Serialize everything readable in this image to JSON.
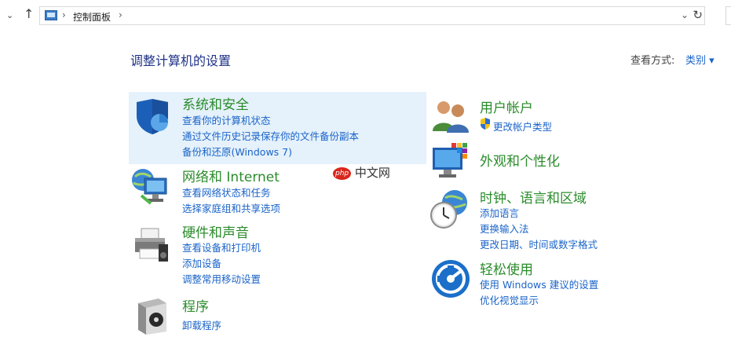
{
  "address_bar": {
    "crumb": "控制面板",
    "sep": "›",
    "nav_chevron": "⌄",
    "up_arrow": "↑",
    "dropdown": "⌄",
    "refresh": "↻"
  },
  "header": {
    "title": "调整计算机的设置",
    "view_by_label": "查看方式:",
    "view_by_value": "类别 ▾"
  },
  "categories_left": [
    {
      "title": "系统和安全",
      "links": [
        "查看你的计算机状态",
        "通过文件历史记录保存你的文件备份副本",
        "备份和还原(Windows 7)"
      ]
    },
    {
      "title": "网络和 Internet",
      "links": [
        "查看网络状态和任务",
        "选择家庭组和共享选项"
      ]
    },
    {
      "title": "硬件和声音",
      "links": [
        "查看设备和打印机",
        "添加设备",
        "调整常用移动设置"
      ]
    },
    {
      "title": "程序",
      "links": [
        "卸载程序"
      ]
    }
  ],
  "categories_right": [
    {
      "title": "用户帐户",
      "links": [
        "更改帐户类型"
      ]
    },
    {
      "title": "外观和个性化",
      "links": []
    },
    {
      "title": "时钟、语言和区域",
      "links": [
        "添加语言",
        "更换输入法",
        "更改日期、时间或数字格式"
      ]
    },
    {
      "title": "轻松使用",
      "links": [
        "使用 Windows 建议的设置",
        "优化视觉显示"
      ]
    }
  ],
  "watermark": {
    "badge": "php",
    "text": "中文网"
  },
  "colors": {
    "category_title": "#2b8c2b",
    "link": "#1a64c8",
    "highlight": "#e5f1fb",
    "page_title": "#1e3287"
  }
}
